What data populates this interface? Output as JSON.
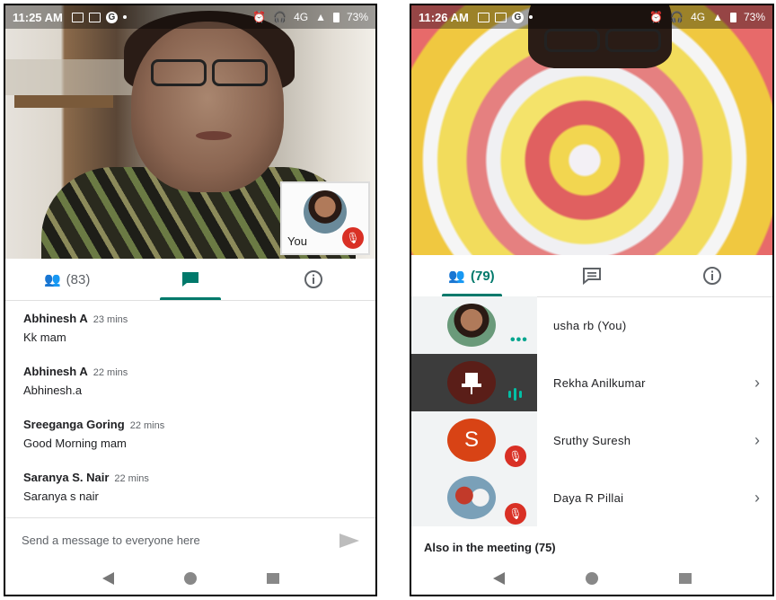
{
  "left": {
    "status": {
      "time": "11:25 AM",
      "network": "4G",
      "battery": "73%"
    },
    "self_tile_label": "You",
    "tabs": [
      {
        "icon": "people-icon",
        "label": "(83)"
      },
      {
        "icon": "chat-icon",
        "label": ""
      },
      {
        "icon": "info-icon",
        "label": ""
      }
    ],
    "messages": [
      {
        "sender": "Abhinesh A",
        "time": "23 mins",
        "text": "Kk mam"
      },
      {
        "sender": "Abhinesh A",
        "time": "22 mins",
        "text": "Abhinesh.a"
      },
      {
        "sender": "Sreeganga Goring",
        "time": "22 mins",
        "text": "Good Morning mam"
      },
      {
        "sender": "Saranya S. Nair",
        "time": "22 mins",
        "text": "Saranya s nair"
      }
    ],
    "compose_placeholder": "Send a message to everyone here"
  },
  "right": {
    "status": {
      "time": "11:26 AM",
      "network": "4G",
      "battery": "73%"
    },
    "tabs": [
      {
        "icon": "people-icon",
        "label": "(79)"
      },
      {
        "icon": "chat-icon",
        "label": ""
      },
      {
        "icon": "info-icon",
        "label": ""
      }
    ],
    "participants": [
      {
        "name": "usha rb (You)",
        "avatar": "photo",
        "indicator": "more-dots"
      },
      {
        "name": "Rekha Anilkumar",
        "avatar": "pin",
        "indicator": "speaking"
      },
      {
        "name": "Sruthy Suresh",
        "avatar": "S",
        "indicator": "muted"
      },
      {
        "name": "Daya R Pillai",
        "avatar": "photo",
        "indicator": "muted"
      }
    ],
    "also_in_meeting": "Also in the meeting (75)"
  },
  "colors": {
    "accent": "#00796b",
    "muted": "#d93025",
    "avatar_s": "#d84315"
  }
}
